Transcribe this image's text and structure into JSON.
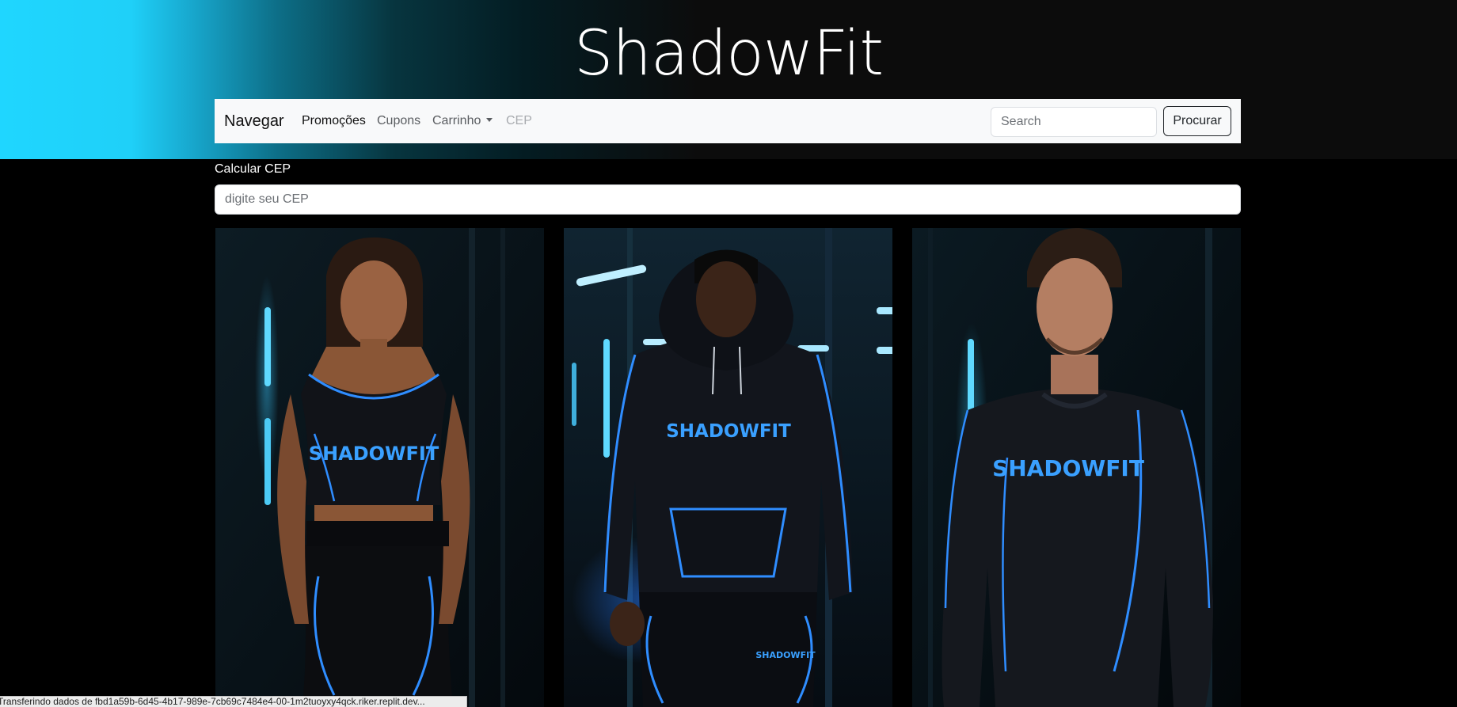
{
  "header": {
    "brand_title": "ShadowFit",
    "gradient_colors": [
      "#1fd6ff",
      "#0d6f88",
      "#0c0c0c"
    ]
  },
  "navbar": {
    "brand": "Navegar",
    "links": [
      {
        "label": "Promoções",
        "state": "active"
      },
      {
        "label": "Cupons",
        "state": "normal"
      },
      {
        "label": "Carrinho",
        "state": "dropdown"
      },
      {
        "label": "CEP",
        "state": "disabled"
      }
    ],
    "search": {
      "placeholder": "Search",
      "value": ""
    },
    "search_button": "Procurar"
  },
  "cep": {
    "label": "Calcular CEP",
    "placeholder": "digite seu CEP",
    "value": ""
  },
  "products": [
    {
      "garment": "tank top and leggings",
      "shirt_text": "SHADOWFIT",
      "accent": "#2f8dff"
    },
    {
      "garment": "hoodie and joggers",
      "shirt_text": "SHADOWFIT",
      "pants_text": "SHADOWFIT",
      "accent": "#2f8dff"
    },
    {
      "garment": "long sleeve compression shirt",
      "shirt_text": "SHADOWFIT",
      "accent": "#2f8dff"
    }
  ],
  "status_bar": {
    "text": "Transferindo dados de fbd1a59b-6d45-4b17-989e-7cb69c7484e4-00-1m2tuoyxy4qck.riker.replit.dev..."
  }
}
